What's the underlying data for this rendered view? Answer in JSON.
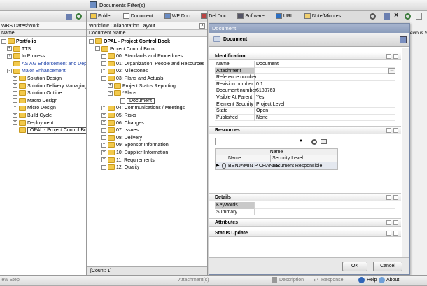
{
  "window": {
    "title": "Documents Filter(s)"
  },
  "toolbar": {
    "items": [
      "Folder",
      "Document",
      "WP Doc",
      "Del Doc",
      "Software",
      "URL",
      "Note/Minutes"
    ],
    "prev_label": "evious St"
  },
  "left": {
    "header": "WBS Dates/Work",
    "column": "Name",
    "tree": [
      {
        "label": "Portfolio",
        "bold": true,
        "level": 0,
        "pm": "-"
      },
      {
        "label": "TTS",
        "level": 1,
        "pm": "+"
      },
      {
        "label": "In Process",
        "level": 1,
        "pm": "+"
      },
      {
        "label": "AS AG Endorsement and Deplo",
        "level": 1,
        "pm": "",
        "blue": true
      },
      {
        "label": "Major Enhancement",
        "level": 1,
        "pm": "-",
        "blue": true
      },
      {
        "label": "Solution Design",
        "level": 2,
        "pm": "+"
      },
      {
        "label": "Solution Delivery Managing",
        "level": 2,
        "pm": "+"
      },
      {
        "label": "Solution Outline",
        "level": 2,
        "pm": "+"
      },
      {
        "label": "Macro Design",
        "level": 2,
        "pm": "+"
      },
      {
        "label": "Micro Design",
        "level": 2,
        "pm": "+"
      },
      {
        "label": "Build Cycle",
        "level": 2,
        "pm": "+"
      },
      {
        "label": "Deployment",
        "level": 2,
        "pm": "+"
      },
      {
        "label": "OPAL - Project Control Boo",
        "level": 2,
        "pm": "",
        "sel": true
      }
    ]
  },
  "mid": {
    "header": "Workflow Collaboration Layout",
    "column": "Document Name",
    "count": "[Count: 1]",
    "tree": [
      {
        "label": "OPAL - Project Control Book",
        "bold": true,
        "level": 0,
        "pm": "-"
      },
      {
        "label": "Project Control Book",
        "level": 1,
        "pm": "-"
      },
      {
        "label": "00: Standards and Procedures",
        "level": 2,
        "pm": "+"
      },
      {
        "label": "01: Organization, People and Resources",
        "level": 2,
        "pm": "+"
      },
      {
        "label": "02: Milestones",
        "level": 2,
        "pm": "+"
      },
      {
        "label": "03: Plans and Actuals",
        "level": 2,
        "pm": "-"
      },
      {
        "label": "Project Status Reporting",
        "level": 3,
        "pm": "+"
      },
      {
        "label": "*Plans",
        "level": 3,
        "pm": "-"
      },
      {
        "label": "Document",
        "level": 4,
        "pm": "",
        "doc": true,
        "sel": true
      },
      {
        "label": "04: Communications / Meetings",
        "level": 2,
        "pm": "+"
      },
      {
        "label": "05: Risks",
        "level": 2,
        "pm": "+"
      },
      {
        "label": "06: Changes",
        "level": 2,
        "pm": "+"
      },
      {
        "label": "07: Issues",
        "level": 2,
        "pm": "+"
      },
      {
        "label": "08: Delivery",
        "level": 2,
        "pm": "+"
      },
      {
        "label": "09: Sponsor Information",
        "level": 2,
        "pm": "+"
      },
      {
        "label": "10: Supplier Information",
        "level": 2,
        "pm": "+"
      },
      {
        "label": "11: Requirements",
        "level": 2,
        "pm": "+"
      },
      {
        "label": "12: Quality",
        "level": 2,
        "pm": "+"
      }
    ]
  },
  "dialog": {
    "title": "Document",
    "banner": "Document",
    "identification": {
      "label": "Identification",
      "rows": [
        {
          "k": "Name",
          "v": "Document"
        },
        {
          "k": "Attachment",
          "v": ""
        },
        {
          "k": "Reference number",
          "v": ""
        },
        {
          "k": "Revision number",
          "v": "0.1"
        },
        {
          "k": "Document number",
          "v": "6180763"
        },
        {
          "k": "Visible At Parent",
          "v": "Yes"
        },
        {
          "k": "Element Security",
          "v": "Project Level"
        },
        {
          "k": "State",
          "v": "Open"
        },
        {
          "k": "Published",
          "v": "None"
        }
      ]
    },
    "resources": {
      "label": "Resources",
      "grid_header": "Name",
      "col_name": "Name",
      "col_sec": "Security Level",
      "row_name": "BENJAMIN P CHANCE",
      "row_sec": "Document Responsible"
    },
    "details": {
      "label": "Details",
      "rows": [
        {
          "k": "Keywords",
          "v": ""
        },
        {
          "k": "Summary",
          "v": ""
        }
      ]
    },
    "attributes": {
      "label": "Attributes"
    },
    "status": {
      "label": "Status Update"
    },
    "ok": "OK",
    "cancel": "Cancel"
  },
  "statusbar": {
    "new_step": "lew Step",
    "attachments": "Attachment(s)",
    "description": "Description",
    "response": "Response",
    "help": "Help",
    "about": "About"
  }
}
